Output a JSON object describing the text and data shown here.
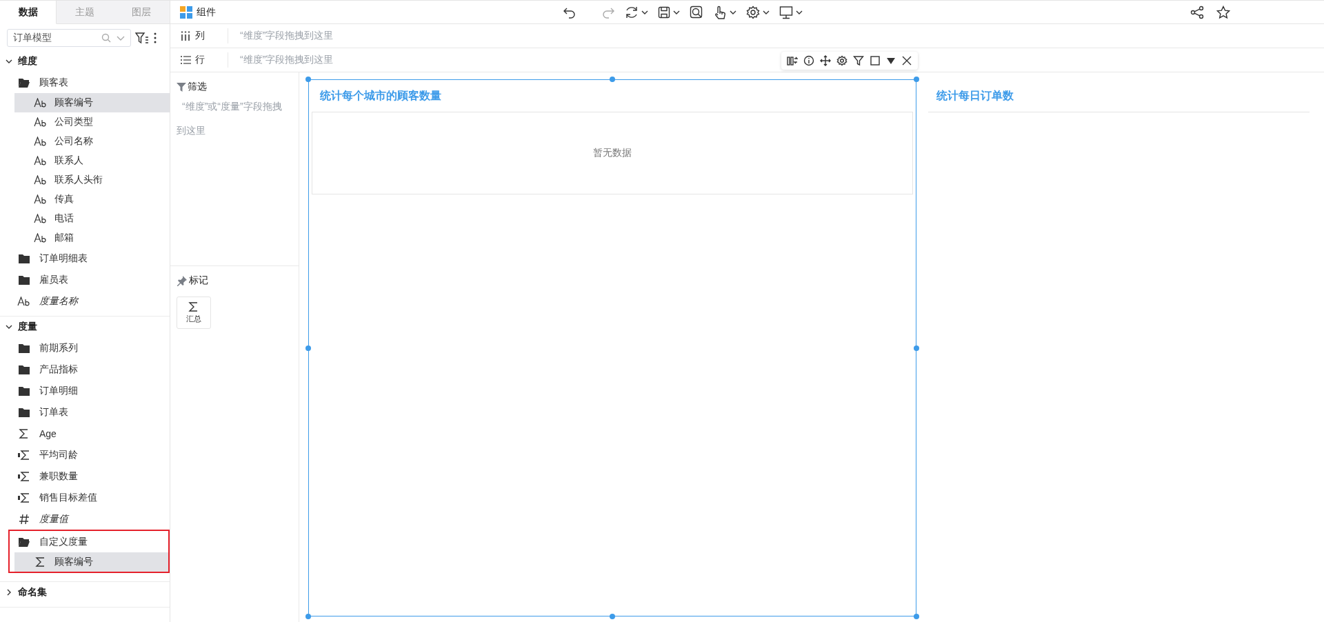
{
  "sidebar": {
    "tabs": [
      {
        "label": "数据",
        "selected": true
      },
      {
        "label": "主题",
        "selected": false
      },
      {
        "label": "图层",
        "selected": false
      }
    ],
    "model_select": {
      "value": "订单模型"
    },
    "groups": [
      {
        "label": "维度",
        "expanded": true,
        "items": [
          {
            "kind": "folder",
            "label": "顾客表",
            "expanded": true,
            "selected": false,
            "highlighted": false,
            "children": [
              {
                "kind": "text",
                "label": "顾客编号",
                "selected": true
              },
              {
                "kind": "text",
                "label": "公司类型",
                "selected": false
              },
              {
                "kind": "text",
                "label": "公司名称",
                "selected": false
              },
              {
                "kind": "text",
                "label": "联系人",
                "selected": false
              },
              {
                "kind": "text",
                "label": "联系人头衔",
                "selected": false
              },
              {
                "kind": "text",
                "label": "传真",
                "selected": false
              },
              {
                "kind": "text",
                "label": "电话",
                "selected": false
              },
              {
                "kind": "text",
                "label": "邮箱",
                "selected": false
              }
            ]
          },
          {
            "kind": "folder",
            "label": "订单明细表",
            "expanded": false,
            "selected": false,
            "highlighted": false
          },
          {
            "kind": "folder",
            "label": "雇员表",
            "expanded": false,
            "selected": false,
            "highlighted": false
          },
          {
            "kind": "measure-names",
            "label": "度量名称",
            "selected": false,
            "highlighted": false
          }
        ]
      },
      {
        "label": "度量",
        "expanded": true,
        "items": [
          {
            "kind": "folder",
            "label": "前期系列",
            "expanded": false,
            "selected": false,
            "highlighted": false
          },
          {
            "kind": "folder",
            "label": "产品指标",
            "expanded": false,
            "selected": false,
            "highlighted": false
          },
          {
            "kind": "folder",
            "label": "订单明细",
            "expanded": false,
            "selected": false,
            "highlighted": false
          },
          {
            "kind": "folder",
            "label": "订单表",
            "expanded": false,
            "selected": false,
            "highlighted": false
          },
          {
            "kind": "measure",
            "label": "Age",
            "selected": false,
            "highlighted": false
          },
          {
            "kind": "calc-measure",
            "label": "平均司龄",
            "selected": false,
            "highlighted": false
          },
          {
            "kind": "calc-measure",
            "label": "兼职数量",
            "selected": false,
            "highlighted": false
          },
          {
            "kind": "calc-measure",
            "label": "销售目标差值",
            "selected": false,
            "highlighted": false
          },
          {
            "kind": "measure-values",
            "label": "度量值",
            "selected": false,
            "highlighted": false
          },
          {
            "kind": "folder",
            "label": "自定义度量",
            "expanded": true,
            "selected": false,
            "highlighted": true,
            "children": [
              {
                "kind": "measure",
                "label": "顾客编号",
                "selected": true
              }
            ]
          }
        ]
      },
      {
        "label": "命名集",
        "expanded": false
      }
    ]
  },
  "topbar": {
    "title": "组件"
  },
  "shelves": [
    {
      "kind": "columns",
      "label": "列",
      "placeholder": "“维度”字段拖拽到这里"
    },
    {
      "kind": "rows",
      "label": "行",
      "placeholder": "“维度”字段拖拽到这里"
    }
  ],
  "filter": {
    "title": "筛选",
    "hint": "“维度”或“度量”字段拖拽到这里"
  },
  "marks": {
    "title": "标记",
    "cards": [
      {
        "label": "汇总"
      }
    ]
  },
  "charts": [
    {
      "title": "统计每个城市的顾客数量",
      "selected": true,
      "message": "暂无数据"
    },
    {
      "title": "统计每日订单数",
      "selected": false
    }
  ]
}
